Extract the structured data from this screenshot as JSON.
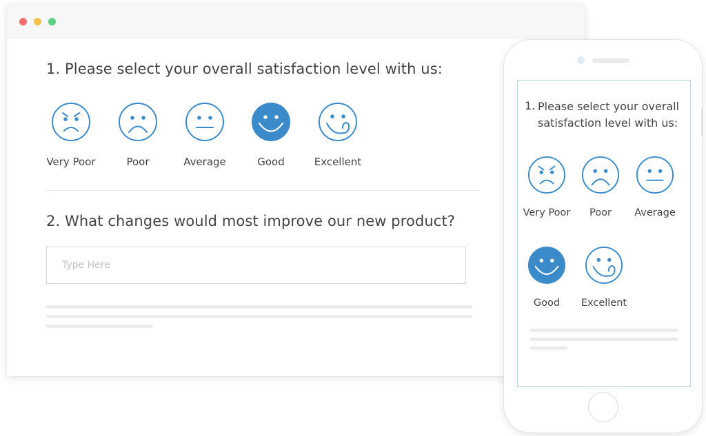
{
  "desktop": {
    "question1": "1. Please select your overall satisfaction level with us:",
    "ratings": [
      {
        "label": "Very Poor",
        "icon": "very-poor-face-icon",
        "selected": false
      },
      {
        "label": "Poor",
        "icon": "poor-face-icon",
        "selected": false
      },
      {
        "label": "Average",
        "icon": "average-face-icon",
        "selected": false
      },
      {
        "label": "Good",
        "icon": "good-face-icon",
        "selected": true
      },
      {
        "label": "Excellent",
        "icon": "excellent-face-icon",
        "selected": false
      }
    ],
    "question2": "2. What changes would most improve our new product?",
    "input": {
      "placeholder": "Type Here",
      "value": ""
    }
  },
  "mobile": {
    "question_number": "1.",
    "question_text": "Please select your overall satisfaction level with us:",
    "ratings": [
      {
        "label": "Very Poor",
        "icon": "very-poor-face-icon",
        "selected": false
      },
      {
        "label": "Poor",
        "icon": "poor-face-icon",
        "selected": false
      },
      {
        "label": "Average",
        "icon": "average-face-icon",
        "selected": false
      },
      {
        "label": "Good",
        "icon": "good-face-icon",
        "selected": true
      },
      {
        "label": "Excellent",
        "icon": "excellent-face-icon",
        "selected": false
      }
    ]
  },
  "colors": {
    "accent": "#3b8bcb",
    "text": "#444444",
    "placeholder": "#c2c2c2",
    "skeleton": "#ececec",
    "window_close": "#f26b6b",
    "window_minimize": "#f5c14f",
    "window_maximize": "#5fcf82"
  }
}
